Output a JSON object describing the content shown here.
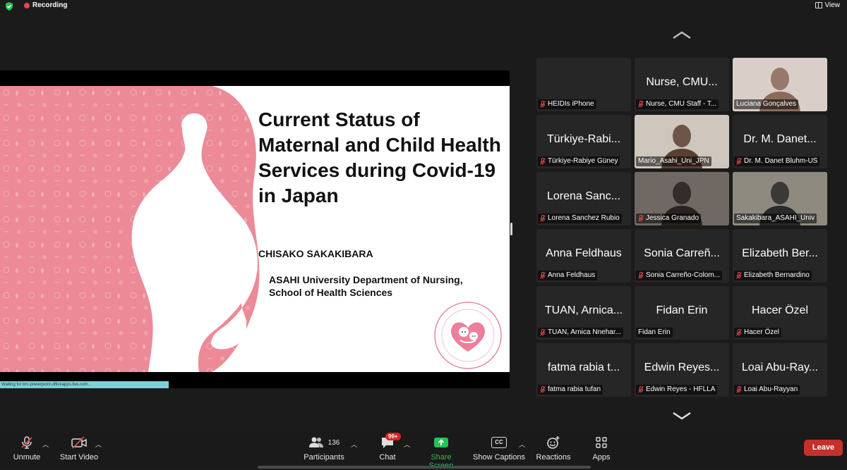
{
  "topbar": {
    "recording_label": "Recording",
    "view_label": "View"
  },
  "slide": {
    "title": "Current Status of Maternal and Child Health Services during Covid-19 in Japan",
    "author": "CHISAKO SAKAKIBARA",
    "affiliation_line1": "ASAHI University Department of Nursing,",
    "affiliation_line2": "School of Health Sciences",
    "pink_color": "#ec8a98"
  },
  "status_strip": "Waiting for brc-powerpoint.officeapps.live.com...",
  "participants": [
    {
      "big": "",
      "name": "HEIDIs iPhone",
      "muted": true,
      "video": false
    },
    {
      "big": "Nurse, CMU...",
      "name": "Nurse, CMU Staff - T...",
      "muted": true,
      "video": false
    },
    {
      "big": "",
      "name": "Luciana Gonçalves",
      "muted": false,
      "video": true
    },
    {
      "big": "Türkiye-Rabi...",
      "name": "Türkiye-Rabiye Güney",
      "muted": true,
      "video": false
    },
    {
      "big": "",
      "name": "Mario_Asahi_Uni_JPN",
      "muted": false,
      "video": true
    },
    {
      "big": "Dr. M. Danet...",
      "name": "Dr. M. Danet Bluhm-US",
      "muted": true,
      "video": false
    },
    {
      "big": "Lorena Sanc...",
      "name": "Lorena Sanchez Rubio",
      "muted": true,
      "video": false
    },
    {
      "big": "",
      "name": "Jessica Granado",
      "muted": true,
      "video": true
    },
    {
      "big": "",
      "name": "Sakakibara_ASAHI_Univ",
      "muted": false,
      "video": true,
      "active": true
    },
    {
      "big": "Anna Feldhaus",
      "name": "Anna Feldhaus",
      "muted": true,
      "video": false
    },
    {
      "big": "Sonia Carreñ...",
      "name": "Sonia Carreño-Colom...",
      "muted": true,
      "video": false
    },
    {
      "big": "Elizabeth Ber...",
      "name": "Elizabeth Bernardino",
      "muted": true,
      "video": false
    },
    {
      "big": "TUAN, Arnica...",
      "name": "TUAN, Arnica Nnehar...",
      "muted": true,
      "video": false
    },
    {
      "big": "Fidan Erin",
      "name": "Fidan Erin",
      "muted": false,
      "video": false
    },
    {
      "big": "Hacer Özel",
      "name": "Hacer Özel",
      "muted": true,
      "video": false
    },
    {
      "big": "fatma rabia t...",
      "name": "fatma rabia tufan",
      "muted": true,
      "video": false
    },
    {
      "big": "Edwin Reyes...",
      "name": "Edwin Reyes - HFLLA",
      "muted": true,
      "video": false
    },
    {
      "big": "Loai Abu-Ray...",
      "name": "Loai Abu-Rayyan",
      "muted": true,
      "video": false
    }
  ],
  "toolbar": {
    "unmute": "Unmute",
    "start_video": "Start Video",
    "participants": "Participants",
    "participant_count": "136",
    "chat": "Chat",
    "chat_badge": "99+",
    "share_screen": "Share Screen",
    "show_captions": "Show Captions",
    "cc_icon_text": "CC",
    "reactions": "Reactions",
    "apps": "Apps",
    "leave": "Leave",
    "accent_green": "#23c552",
    "leave_red": "#c5302b"
  }
}
